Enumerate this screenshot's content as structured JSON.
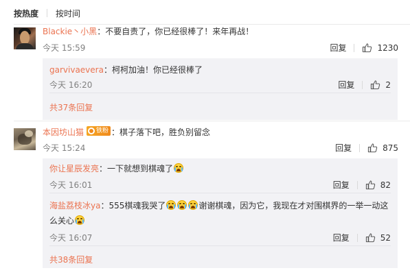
{
  "sort": {
    "hot_label": "按热度",
    "time_label": "按时间"
  },
  "comments": [
    {
      "user": "Blackie丶小黑",
      "text": "：不要自责了，你已经很棒了！来年再战！",
      "time": "今天 15:59",
      "reply_label": "回复",
      "likes": "1230",
      "replies": [
        {
          "user": "garvivaevera",
          "text": "：柯柯加油！你已经很棒了",
          "time": "今天 16:20",
          "reply_label": "回复",
          "likes": "2"
        }
      ],
      "more_label": "共37条回复"
    },
    {
      "user": "本因坊山猫",
      "badge": "铁粉",
      "text": "：棋子落下吧，胜负别留念",
      "time": "今天 15:24",
      "reply_label": "回复",
      "likes": "875",
      "replies": [
        {
          "user": "你让星辰发亮",
          "text": "：一下就想到棋魂了",
          "time": "今天 16:01",
          "reply_label": "回复",
          "likes": "82"
        },
        {
          "user": "海盐荔枝冰ya",
          "text_a": "：555棋魂我哭了",
          "text_b": "谢谢棋魂，因为它，我现在才对围棋界的一举一动这",
          "text_c": "么关心",
          "time": "今天 16:07",
          "reply_label": "回复",
          "likes": "52"
        }
      ],
      "more_label": "共38条回复"
    }
  ],
  "icons": {
    "like": "thumbs-up-icon",
    "emoji": "crying-face-emoji-icon",
    "badge": "fan-badge-icon"
  },
  "colors": {
    "username": "#eb7350",
    "meta": "#808080",
    "subbox_bg": "#f2f2f5"
  }
}
